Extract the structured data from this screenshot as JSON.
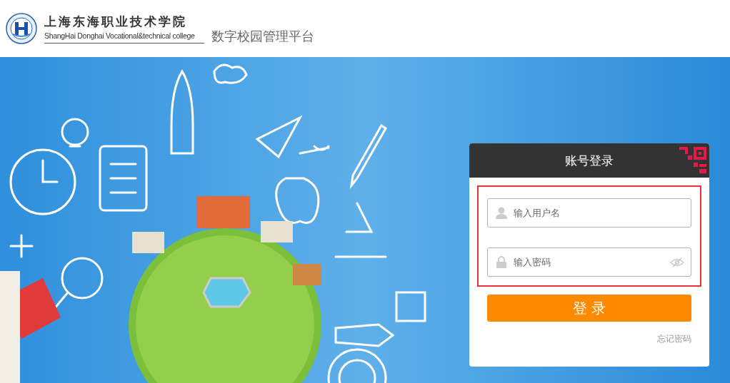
{
  "header": {
    "school_name": "上海东海职业技术学院",
    "school_name_en": "ShangHai Donghai Vocational&technical college",
    "platform_name": "数字校园管理平台"
  },
  "login": {
    "title": "账号登录",
    "username": {
      "placeholder": "输入用户名"
    },
    "password": {
      "placeholder": "输入密码"
    },
    "submit": "登 录",
    "forgot_link": "忘记密码"
  }
}
